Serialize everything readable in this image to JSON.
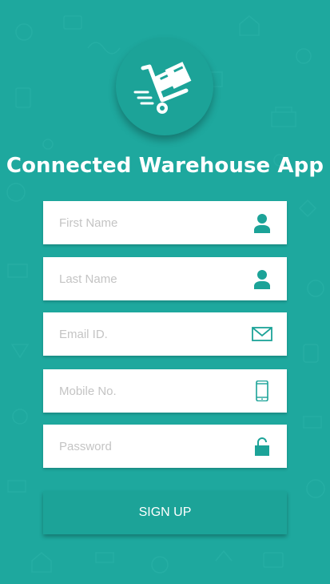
{
  "app": {
    "title": "Connected Warehouse App",
    "logo_icon": "hand-truck-icon"
  },
  "form": {
    "fields": [
      {
        "placeholder": "First Name",
        "value": "",
        "icon": "user-icon"
      },
      {
        "placeholder": "Last Name",
        "value": "",
        "icon": "user-icon"
      },
      {
        "placeholder": "Email ID.",
        "value": "",
        "icon": "envelope-icon"
      },
      {
        "placeholder": "Mobile No.",
        "value": "",
        "icon": "mobile-phone-icon"
      },
      {
        "placeholder": "Password",
        "value": "",
        "icon": "lock-icon"
      }
    ],
    "submit_label": "SIGN UP"
  },
  "colors": {
    "background": "#1ea89e",
    "accent": "#1ca398",
    "field_background": "#ffffff",
    "placeholder": "#c4c4c4",
    "text": "#ffffff"
  }
}
